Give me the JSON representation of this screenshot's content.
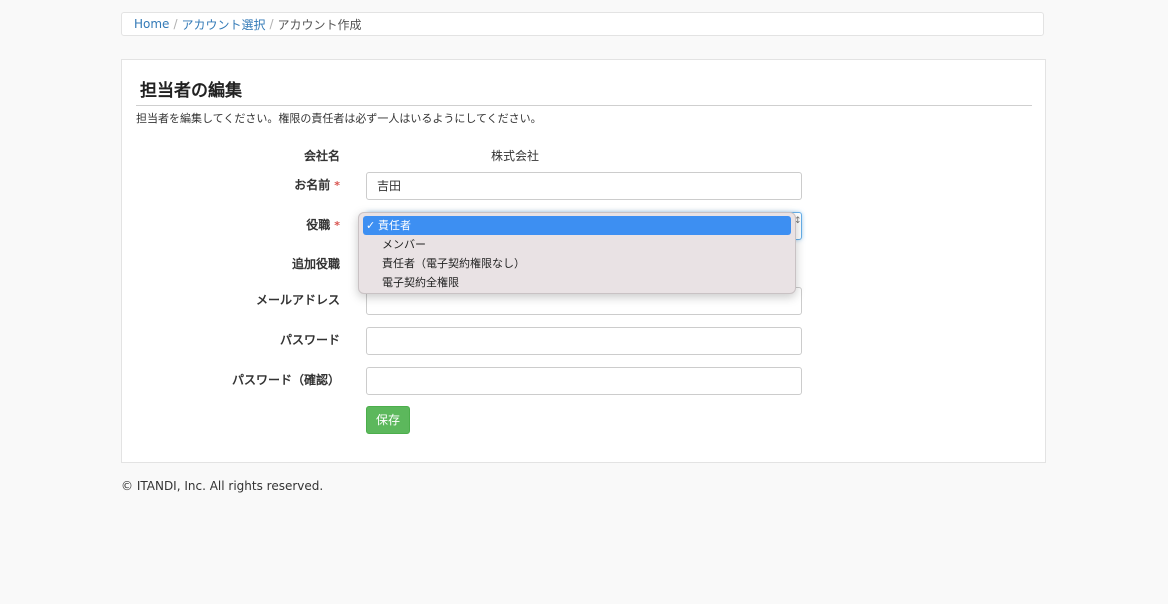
{
  "breadcrumb": {
    "home": "Home",
    "sep": "/",
    "accounts": "アカウント選択",
    "current": "アカウント作成"
  },
  "panel": {
    "title": "担当者の編集",
    "description": "担当者を編集してください。権限の責任者は必ず一人はいるようにしてください。"
  },
  "form": {
    "company_label": "会社名",
    "company_value": "株式会社",
    "name_label": "お名前",
    "name_value": "吉田",
    "role_label": "役職",
    "extra_role_label": "追加役職",
    "email_label": "メールアドレス",
    "email_value": "",
    "password_label": "パスワード",
    "password_value": "",
    "password_confirm_label": "パスワード（確認）",
    "password_confirm_value": "",
    "required_mark": "*",
    "save_label": "保存"
  },
  "role_dropdown": {
    "selected_index": 0,
    "options": [
      "責任者",
      "メンバー",
      "責任者（電子契約権限なし）",
      "電子契約全権限"
    ]
  },
  "footer": {
    "copyright": "© ITANDI, Inc. All rights reserved."
  },
  "colors": {
    "link": "#337ab7",
    "save_button": "#5cb85c",
    "required": "#d9534f",
    "dropdown_highlight": "#3d8ff2"
  }
}
